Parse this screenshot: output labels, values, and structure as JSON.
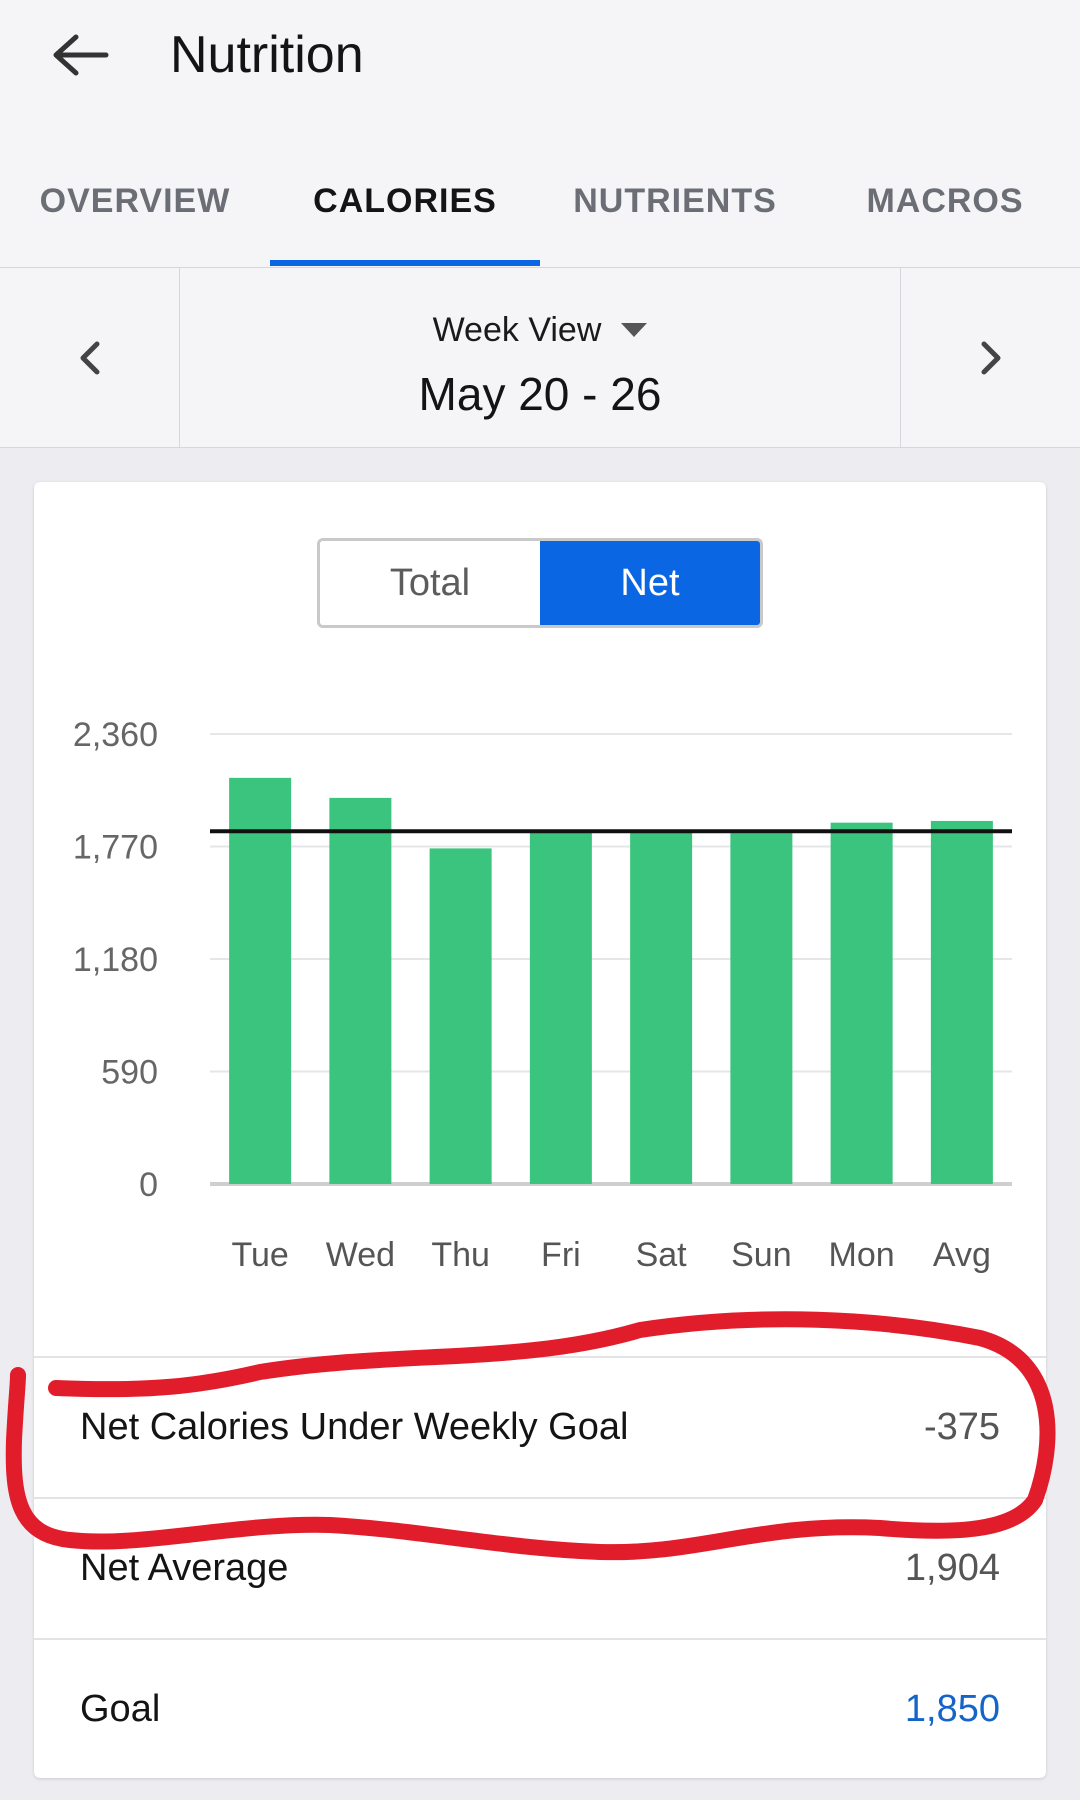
{
  "header": {
    "title": "Nutrition",
    "back_icon": "arrow-left-icon"
  },
  "tabs": [
    {
      "label": "OVERVIEW",
      "active": false
    },
    {
      "label": "CALORIES",
      "active": true
    },
    {
      "label": "NUTRIENTS",
      "active": false
    },
    {
      "label": "MACROS",
      "active": false
    }
  ],
  "week_nav": {
    "view_label": "Week View",
    "range": "May 20 - 26"
  },
  "toggle": {
    "total_label": "Total",
    "net_label": "Net",
    "selected": "Net"
  },
  "chart_data": {
    "type": "bar",
    "categories": [
      "Tue",
      "Wed",
      "Thu",
      "Fri",
      "Sat",
      "Sun",
      "Mon",
      "Avg"
    ],
    "values": [
      2130,
      2025,
      1760,
      1845,
      1845,
      1840,
      1895,
      1904
    ],
    "goal_line": 1850,
    "ylim": [
      0,
      2360
    ],
    "yticks": [
      0,
      590,
      1180,
      1770,
      2360
    ],
    "ytick_labels": [
      "0",
      "590",
      "1,180",
      "1,770",
      "2,360"
    ],
    "grid": true,
    "bar_color": "#3ac47d",
    "goal_line_color": "#111111"
  },
  "summary": {
    "under_goal_label": "Net Calories Under Weekly Goal",
    "under_goal_value": "-375",
    "net_average_label": "Net Average",
    "net_average_value": "1,904",
    "goal_label": "Goal",
    "goal_value": "1,850"
  },
  "colors": {
    "accent": "#0b66e4",
    "bar": "#3ac47d",
    "annotation": "#e11d2c",
    "link": "#1565c8"
  }
}
